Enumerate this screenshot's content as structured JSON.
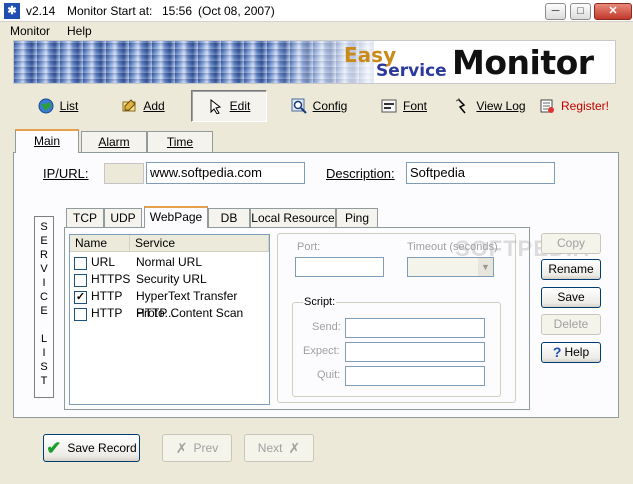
{
  "window": {
    "version": "v2.14",
    "monitor_start_label": "Monitor Start at:",
    "monitor_start_time": "15:56",
    "monitor_start_date": "(Oct 08, 2007)",
    "min_symbol": "─",
    "max_symbol": "□",
    "close_symbol": "✕"
  },
  "menu": [
    "Monitor",
    "Help"
  ],
  "banner": {
    "easy": "Easy",
    "service": "Service",
    "monitor": "Monitor"
  },
  "toolbar": {
    "list": "List",
    "add": "Add",
    "edit": "Edit",
    "config": "Config",
    "font": "Font",
    "view_log": "View Log",
    "register": "Register!",
    "register_color": "#c00000"
  },
  "main_tabs": [
    "Main",
    "Alarm",
    "Time"
  ],
  "main": {
    "ip_label": "IP/URL:",
    "ip_value": "www.softpedia.com",
    "desc_label": "Description:",
    "desc_value": "Softpedia"
  },
  "service_list_label": [
    "S",
    "E",
    "R",
    "V",
    "I",
    "C",
    "E",
    "",
    "L",
    "I",
    "S",
    "T"
  ],
  "sub_tabs": [
    "TCP",
    "UDP",
    "WebPage",
    "DB",
    "Local Resource",
    "Ping"
  ],
  "list": {
    "headers": [
      "Name",
      "Service"
    ],
    "rows": [
      {
        "checked": false,
        "name": "URL",
        "service": "Normal URL"
      },
      {
        "checked": false,
        "name": "HTTPS",
        "service": "Security URL"
      },
      {
        "checked": true,
        "name": "HTTP",
        "service": "HyperText Transfer Proto..."
      },
      {
        "checked": false,
        "name": "HTTP",
        "service": "HTTP Content Scan"
      }
    ]
  },
  "details": {
    "port_label": "Port:",
    "timeout_label": "Timeout (seconds)",
    "script_label": "Script:",
    "send_label": "Send:",
    "expect_label": "Expect:",
    "quit_label": "Quit:"
  },
  "side_buttons": {
    "copy": "Copy",
    "rename": "Rename",
    "save": "Save",
    "delete": "Delete",
    "help": "Help"
  },
  "bottom": {
    "save_record": "Save Record",
    "prev": "Prev",
    "next": "Next"
  },
  "watermark": "SOFTPEDIA"
}
